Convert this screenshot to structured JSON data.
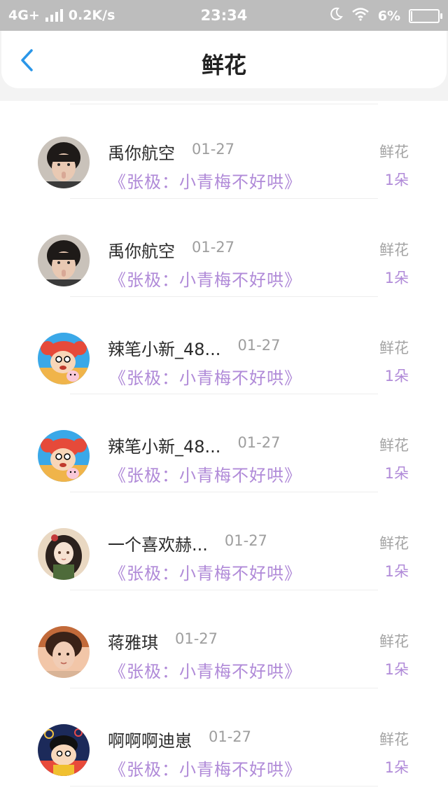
{
  "status_bar": {
    "network": "4G+",
    "speed": "0.2K/s",
    "time": "23:34",
    "battery": "6%",
    "icons": [
      "signal-icon",
      "moon-icon",
      "wifi-icon",
      "battery-icon"
    ]
  },
  "header": {
    "title": "鲜花",
    "back_icon": "chevron-left-icon",
    "accent_color": "#2a96e8"
  },
  "colors": {
    "status_bar_bg": "#bdbdbd",
    "book_title": "#b08ad8",
    "name_text": "#2b2b2b",
    "meta_text": "#9e9e9e"
  },
  "items": [
    {
      "name": "禹你航空",
      "date": "01-27",
      "book": "《张极：小青梅不好哄》",
      "gift": "鲜花",
      "count": "1朵",
      "avatar": "boy-photo-avatar"
    },
    {
      "name": "禹你航空",
      "date": "01-27",
      "book": "《张极：小青梅不好哄》",
      "gift": "鲜花",
      "count": "1朵",
      "avatar": "boy-photo-avatar"
    },
    {
      "name": "辣笔小新_48...",
      "date": "01-27",
      "book": "《张极：小青梅不好哄》",
      "gift": "鲜花",
      "count": "1朵",
      "avatar": "cartoon-avatar"
    },
    {
      "name": "辣笔小新_48...",
      "date": "01-27",
      "book": "《张极：小青梅不好哄》",
      "gift": "鲜花",
      "count": "1朵",
      "avatar": "cartoon-avatar"
    },
    {
      "name": "一个喜欢赫...",
      "date": "01-27",
      "book": "《张极：小青梅不好哄》",
      "gift": "鲜花",
      "count": "1朵",
      "avatar": "anime-girl-avatar"
    },
    {
      "name": "蒋雅琪",
      "date": "01-27",
      "book": "《张极：小青梅不好哄》",
      "gift": "鲜花",
      "count": "1朵",
      "avatar": "girl-photo-avatar"
    },
    {
      "name": "啊啊啊迪崽",
      "date": "01-27",
      "book": "《张极：小青梅不好哄》",
      "gift": "鲜花",
      "count": "1朵",
      "avatar": "cartoon-boy-avatar"
    }
  ]
}
